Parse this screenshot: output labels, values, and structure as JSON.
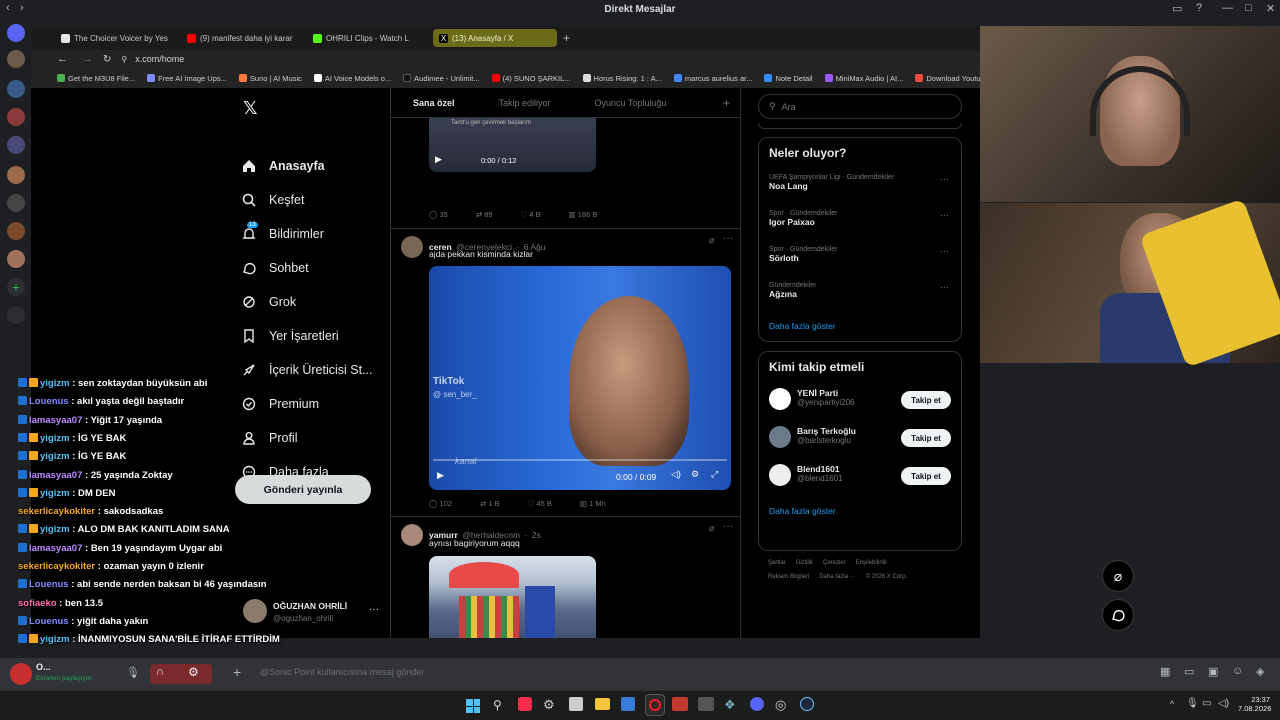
{
  "window": {
    "title": "Direkt Mesajlar"
  },
  "browser": {
    "tabs": [
      {
        "label": "The Choicer Voicer by Yes",
        "color": "#e6e6e6"
      },
      {
        "label": "(9) manifest daha iyi karar",
        "color": "#ff0000"
      },
      {
        "label": "OHRILI Clips - Watch L",
        "color": "#53fc18"
      },
      {
        "label": "(13) Anasayfa / X",
        "color": "#ffffff",
        "active": true
      }
    ],
    "url": "x.com/home",
    "bookmarks": [
      {
        "label": "Get the M3U8 File...",
        "color": "#4caf50"
      },
      {
        "label": "Free AI Image Ups...",
        "color": "#7c8cff"
      },
      {
        "label": "Suno | AI Music",
        "color": "#ff7a3d"
      },
      {
        "label": "AI Voice Models o...",
        "color": "#ffffff"
      },
      {
        "label": "Audimee - Unlimit...",
        "color": "#111111"
      },
      {
        "label": "(4) SUNO ŞARKIL...",
        "color": "#ff0000"
      },
      {
        "label": "Horus Rising: 1 : A...",
        "color": "#dddddd"
      },
      {
        "label": "marcus aurelius ar...",
        "color": "#4285f4"
      },
      {
        "label": "Note Detail",
        "color": "#2d8cff"
      },
      {
        "label": "MiniMax Audio | AI...",
        "color": "#9b59ff"
      },
      {
        "label": "Download Youtube",
        "color": "#e74c3c"
      }
    ]
  },
  "x_nav": {
    "items": [
      {
        "label": "Anasayfa",
        "icon": "home-icon"
      },
      {
        "label": "Keşfet",
        "icon": "search-icon"
      },
      {
        "label": "Bildirimler",
        "icon": "bell-icon",
        "badge": "13"
      },
      {
        "label": "Sohbet",
        "icon": "chat-icon"
      },
      {
        "label": "Grok",
        "icon": "grok-icon"
      },
      {
        "label": "Yer İşaretleri",
        "icon": "bookmark-icon"
      },
      {
        "label": "İçerik Üreticisi St...",
        "icon": "rocket-icon"
      },
      {
        "label": "Premium",
        "icon": "verified-icon"
      },
      {
        "label": "Profil",
        "icon": "person-icon"
      },
      {
        "label": "Daha fazla",
        "icon": "more-circle-icon"
      }
    ],
    "post_button": "Gönderi yayınla",
    "account": {
      "name": "OĞUZHAN OHRİLİ",
      "handle": "@oguzhan_ohrili"
    }
  },
  "feed": {
    "tabs": [
      "Sana özel",
      "Takip ediliyor",
      "Oyuncu Topluluğu"
    ],
    "tweet0": {
      "caption1": "Tarot'u geri çevirmek başlarım",
      "time": "0:00 / 0:12",
      "replies": "35",
      "reposts": "89",
      "likes": "4 B",
      "views": "186 B"
    },
    "tweet1": {
      "name": "ceren",
      "handle": "@cerenyelekci",
      "date": "6 Ağu",
      "text": "ajda pekkan kisminda kizlar",
      "watermark": "TikTok",
      "watermark_handle": "@ sen_ber_",
      "channel": "kanal",
      "time": "0:00 / 0:09",
      "replies": "102",
      "reposts": "1 B",
      "likes": "45 B",
      "views": "1 Mn"
    },
    "tweet2": {
      "name": "yamurr",
      "handle": "@herhaldecnm",
      "date": "2s",
      "text": "aynısı bagiriyorum aqqq"
    }
  },
  "right": {
    "search_placeholder": "Ara",
    "trends_title": "Neler oluyor?",
    "trends": [
      {
        "meta": "UEFA Şampiyonlar Ligi · Gündemdekiler",
        "name": "Noa Lang"
      },
      {
        "meta": "Spor · Gündemdekiler",
        "name": "Igor Paixao"
      },
      {
        "meta": "Spor · Gündemdekiler",
        "name": "Sörloth"
      },
      {
        "meta": "Gündemdekiler",
        "name": "Ağzına"
      }
    ],
    "trends_more": "Daha fazla göster",
    "follow_title": "Kimi takip etmeli",
    "follow": [
      {
        "name": "YENİ Parti",
        "handle": "@yenipartiyi206",
        "button": "Takip et",
        "color": "#ffffff"
      },
      {
        "name": "Barış Terkoğlu",
        "handle": "@baristerkoglu",
        "button": "Takip et",
        "color": "#6b7b8c"
      },
      {
        "name": "Blend1601",
        "handle": "@blend1601",
        "button": "Takip et",
        "color": "#eeeeee"
      }
    ],
    "follow_more": "Daha fazla göster",
    "footer1": [
      "Şartlar",
      "Gizlilik",
      "Çerezler",
      "Erişilebilirlik"
    ],
    "footer2": [
      "Reklam Bilgileri",
      "Daha fazla ···",
      "© 2026 X Corp."
    ]
  },
  "chat": [
    {
      "user": "yigizm",
      "msg": "sen zoktaydan büyüksün abi",
      "color": "#4fc3f7",
      "badges": 2
    },
    {
      "user": "Louenus",
      "msg": "akıl yaşta değil baştadır",
      "color": "#7f8cff",
      "badges": 1
    },
    {
      "user": "lamasyaa07",
      "msg": "Yiğit 17 yaşında",
      "color": "#b98cff",
      "badges": 1
    },
    {
      "user": "yigizm",
      "msg": "İG YE BAK",
      "color": "#4fc3f7",
      "badges": 2
    },
    {
      "user": "yigizm",
      "msg": "İG YE BAK",
      "color": "#4fc3f7",
      "badges": 2
    },
    {
      "user": "lamasyaa07",
      "msg": "25 yaşında Zoktay",
      "color": "#b98cff",
      "badges": 1
    },
    {
      "user": "yigizm",
      "msg": "DM DEN",
      "color": "#4fc3f7",
      "badges": 2
    },
    {
      "user": "sekerlicaykokiter",
      "msg": "sakodsadkas",
      "color": "#f5a623",
      "badges": 0
    },
    {
      "user": "yigizm",
      "msg": "ALO DM BAK KANITLADIM SANA",
      "color": "#4fc3f7",
      "badges": 2
    },
    {
      "user": "lamasyaa07",
      "msg": "Ben 19 yaşındayım Uygar abi",
      "color": "#b98cff",
      "badges": 1
    },
    {
      "user": "sekerlicaykokiter",
      "msg": "ozaman yayın 0 izlenir",
      "color": "#f5a623",
      "badges": 0
    },
    {
      "user": "Louenus",
      "msg": "abi sende nerden baksan bi 46 yaşındasın",
      "color": "#7f8cff",
      "badges": 1
    },
    {
      "user": "sofiaeko",
      "msg": "ben 13.5",
      "color": "#ff6fa8",
      "badges": 0
    },
    {
      "user": "Louenus",
      "msg": "yiğit daha yakın",
      "color": "#7f8cff",
      "badges": 1
    },
    {
      "user": "yigizm",
      "msg": "İNANMIYOSUN SANA'BİLE İTİRAF ETTİRDİM",
      "color": "#4fc3f7",
      "badges": 2
    }
  ],
  "discord": {
    "user_initial": "O...",
    "user_status": "Ekranını paylaşıyor",
    "message_placeholder": "@Sonic Point kullanıcısına mesaj gönder"
  },
  "taskbar": {
    "time": "23:37",
    "date": "7.08.2026"
  }
}
